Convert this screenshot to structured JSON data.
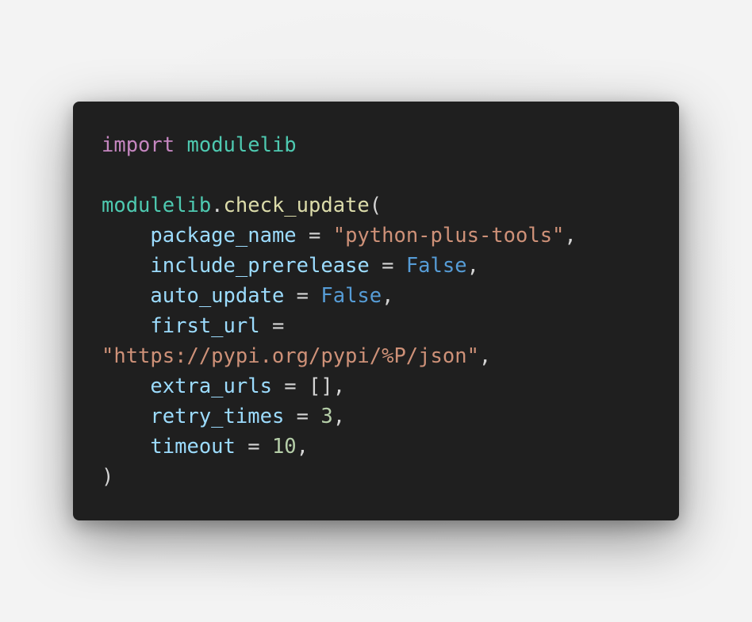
{
  "code": {
    "lines": [
      [
        {
          "t": "import",
          "c": "kw"
        },
        {
          "t": " ",
          "c": "pun"
        },
        {
          "t": "modulelib",
          "c": "mod"
        }
      ],
      [],
      [
        {
          "t": "modulelib",
          "c": "mod"
        },
        {
          "t": ".",
          "c": "pun"
        },
        {
          "t": "check_update",
          "c": "fn"
        },
        {
          "t": "(",
          "c": "pun"
        }
      ],
      [
        {
          "t": "    ",
          "c": "pun"
        },
        {
          "t": "package_name",
          "c": "prm"
        },
        {
          "t": " = ",
          "c": "pun"
        },
        {
          "t": "\"python-plus-tools\"",
          "c": "str"
        },
        {
          "t": ",",
          "c": "pun"
        }
      ],
      [
        {
          "t": "    ",
          "c": "pun"
        },
        {
          "t": "include_prerelease",
          "c": "prm"
        },
        {
          "t": " = ",
          "c": "pun"
        },
        {
          "t": "False",
          "c": "cst"
        },
        {
          "t": ",",
          "c": "pun"
        }
      ],
      [
        {
          "t": "    ",
          "c": "pun"
        },
        {
          "t": "auto_update",
          "c": "prm"
        },
        {
          "t": " = ",
          "c": "pun"
        },
        {
          "t": "False",
          "c": "cst"
        },
        {
          "t": ",",
          "c": "pun"
        }
      ],
      [
        {
          "t": "    ",
          "c": "pun"
        },
        {
          "t": "first_url",
          "c": "prm"
        },
        {
          "t": " =",
          "c": "pun"
        }
      ],
      [
        {
          "t": "\"https://pypi.org/pypi/%P/json\"",
          "c": "str"
        },
        {
          "t": ",",
          "c": "pun"
        }
      ],
      [
        {
          "t": "    ",
          "c": "pun"
        },
        {
          "t": "extra_urls",
          "c": "prm"
        },
        {
          "t": " = [],",
          "c": "pun"
        }
      ],
      [
        {
          "t": "    ",
          "c": "pun"
        },
        {
          "t": "retry_times",
          "c": "prm"
        },
        {
          "t": " = ",
          "c": "pun"
        },
        {
          "t": "3",
          "c": "num"
        },
        {
          "t": ",",
          "c": "pun"
        }
      ],
      [
        {
          "t": "    ",
          "c": "pun"
        },
        {
          "t": "timeout",
          "c": "prm"
        },
        {
          "t": " = ",
          "c": "pun"
        },
        {
          "t": "10",
          "c": "num"
        },
        {
          "t": ",",
          "c": "pun"
        }
      ],
      [
        {
          "t": ")",
          "c": "pun"
        }
      ]
    ]
  },
  "colors": {
    "background": "#f2f2f2",
    "card": "#1f1f1f",
    "keyword": "#c586c0",
    "module": "#4ec9b0",
    "function": "#dcdcaa",
    "parameter": "#9cdcfe",
    "string": "#ce9178",
    "constant": "#569cd6",
    "number": "#b5cea8",
    "punctuation": "#d4d4d4"
  }
}
